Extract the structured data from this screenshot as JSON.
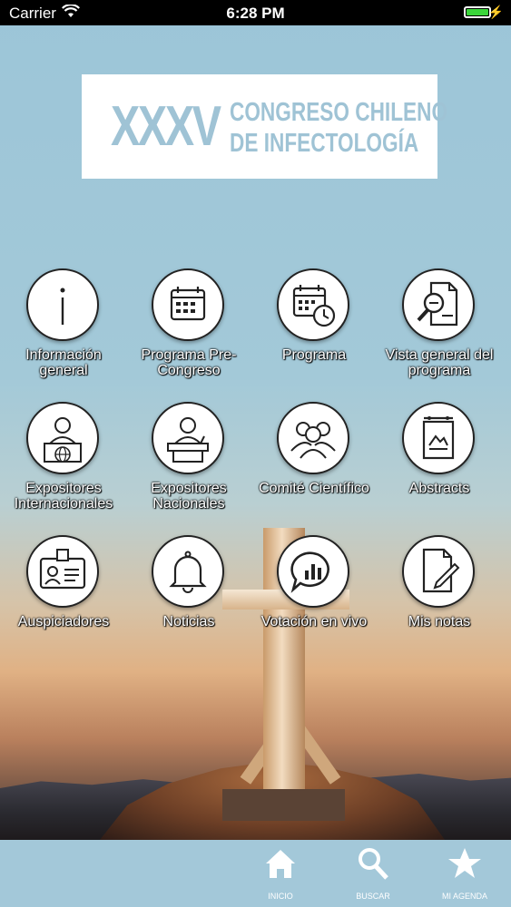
{
  "status_bar": {
    "carrier": "Carrier",
    "time": "6:28 PM"
  },
  "banner": {
    "roman_numeral": "XXXV",
    "line1": "CONGRESO CHILENO",
    "line2": "DE INFECTOLOGÍA"
  },
  "menu": [
    {
      "label": "Información general",
      "icon": "info-icon"
    },
    {
      "label": "Programa Pre-Congreso",
      "icon": "calendar-icon"
    },
    {
      "label": "Programa",
      "icon": "calendar-clock-icon"
    },
    {
      "label": "Vista general del programa",
      "icon": "document-search-icon"
    },
    {
      "label": "Expositores Internacionales",
      "icon": "speaker-globe-icon"
    },
    {
      "label": "Expositores Nacionales",
      "icon": "speaker-podium-icon"
    },
    {
      "label": "Comité Científico",
      "icon": "group-icon"
    },
    {
      "label": "Abstracts",
      "icon": "poster-icon"
    },
    {
      "label": "Auspiciadores",
      "icon": "id-card-icon"
    },
    {
      "label": "Noticias",
      "icon": "bell-icon"
    },
    {
      "label": "Votación en vivo",
      "icon": "poll-chat-icon"
    },
    {
      "label": "Mis notas",
      "icon": "note-edit-icon"
    }
  ],
  "tabbar": {
    "home": "INICIO",
    "search": "BUSCAR",
    "agenda": "MI AGENDA"
  },
  "colors": {
    "accent": "#9fc3d5",
    "battery": "#3bd53b"
  }
}
